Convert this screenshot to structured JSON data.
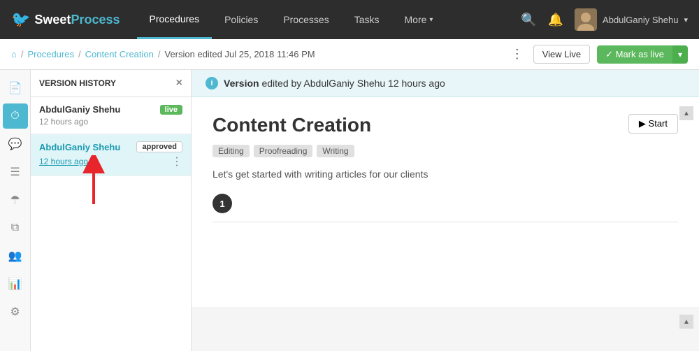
{
  "topnav": {
    "logo_sweet": "Sweet",
    "logo_process": "Process",
    "nav_items": [
      {
        "label": "Procedures",
        "active": true
      },
      {
        "label": "Policies",
        "active": false
      },
      {
        "label": "Processes",
        "active": false
      },
      {
        "label": "Tasks",
        "active": false
      },
      {
        "label": "More",
        "active": false,
        "has_chevron": true
      }
    ],
    "user_name": "AbdulGaniy Shehu",
    "user_chevron": "▾"
  },
  "breadcrumb": {
    "home_icon": "⌂",
    "items": [
      "Procedures",
      "Content Creation",
      "Version edited Jul 25, 2018 11:46 PM"
    ],
    "view_live": "View Live",
    "mark_as_live": "✓ Mark as live"
  },
  "version_panel": {
    "title": "VERSION HISTORY",
    "close": "×",
    "versions": [
      {
        "user": "AbdulGaniy Shehu",
        "badge": "live",
        "time": "12 hours ago",
        "selected": false
      },
      {
        "user": "AbdulGaniy Shehu",
        "badge": "approved",
        "time": "12 hours ago",
        "selected": true
      }
    ]
  },
  "icon_sidebar": {
    "items": [
      {
        "icon": "☰",
        "name": "document",
        "active": false
      },
      {
        "icon": "⏱",
        "name": "history",
        "active": true
      },
      {
        "icon": "💬",
        "name": "comments",
        "active": false
      },
      {
        "icon": "≡",
        "name": "list",
        "active": false
      },
      {
        "icon": "☂",
        "name": "coverage",
        "active": false
      },
      {
        "icon": "⧉",
        "name": "copy",
        "active": false
      },
      {
        "icon": "👥",
        "name": "team",
        "active": false
      },
      {
        "icon": "📊",
        "name": "reports",
        "active": false
      },
      {
        "icon": "⚙",
        "name": "settings",
        "active": false
      }
    ]
  },
  "content": {
    "banner_text": "Version",
    "banner_detail": " edited by AbdulGaniy Shehu 12 hours ago",
    "title": "Content Creation",
    "tags": [
      "Editing",
      "Proofreading",
      "Writing"
    ],
    "start_btn": "▶ Start",
    "description": "Let's get started with writing articles for our clients",
    "step_number": "1"
  }
}
